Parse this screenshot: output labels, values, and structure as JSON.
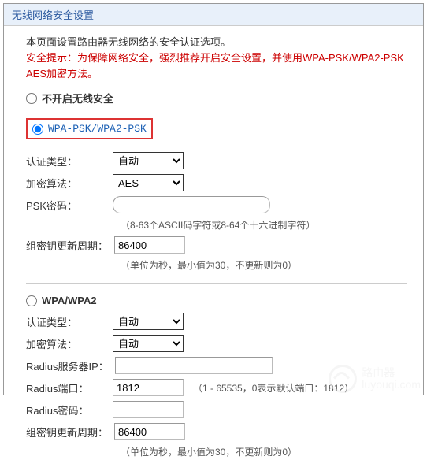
{
  "title": "无线网络安全设置",
  "intro": "本页面设置路由器无线网络的安全认证选项。",
  "warning": "安全提示：为保障网络安全，强烈推荐开启安全设置，并使用WPA-PSK/WPA2-PSK AES加密方法。",
  "options": {
    "none_label": "不开启无线安全",
    "psk_label": "WPA-PSK/WPA2-PSK",
    "wpa_label": "WPA/WPA2"
  },
  "psk": {
    "auth_label": "认证类型：",
    "auth_value": "自动",
    "enc_label": "加密算法：",
    "enc_value": "AES",
    "pwd_label": "PSK密码：",
    "pwd_value": "",
    "pwd_placeholder": "",
    "pwd_hint": "（8-63个ASCII码字符或8-64个十六进制字符）",
    "interval_label": "组密钥更新周期：",
    "interval_value": "86400",
    "interval_hint": "（单位为秒，最小值为30，不更新则为0）"
  },
  "wpa": {
    "auth_label": "认证类型：",
    "auth_value": "自动",
    "enc_label": "加密算法：",
    "enc_value": "自动",
    "radius_ip_label": "Radius服务器IP：",
    "radius_ip_value": "",
    "radius_port_label": "Radius端口：",
    "radius_port_value": "1812",
    "radius_port_hint": "（1 - 65535，0表示默认端口：1812）",
    "radius_pwd_label": "Radius密码：",
    "radius_pwd_value": "",
    "interval_label": "组密钥更新周期：",
    "interval_value": "86400",
    "interval_hint": "（单位为秒，最小值为30，不更新则为0）"
  },
  "watermark": {
    "line1": "路由器",
    "line2": "luyouqi.com"
  }
}
